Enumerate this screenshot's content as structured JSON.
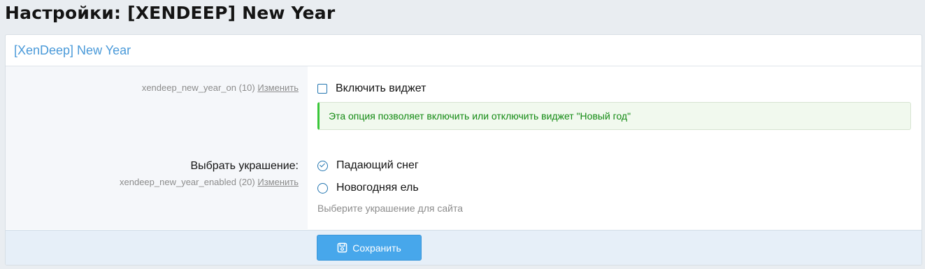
{
  "page": {
    "title": "Настройки: [XENDEEP] New Year"
  },
  "block": {
    "header": "[XenDeep] New Year",
    "row1": {
      "option_id": "xendeep_new_year_on (10)",
      "edit_link": "Изменить",
      "checkbox_label": "Включить виджет",
      "checkbox_checked": false,
      "hint": "Эта опция позволяет включить или отключить виджет \"Новый год\""
    },
    "row2": {
      "title": "Выбрать украшение:",
      "option_id": "xendeep_new_year_enabled (20)",
      "edit_link": "Изменить",
      "options": [
        {
          "label": "Падающий снег",
          "selected": true
        },
        {
          "label": "Новогодняя ель",
          "selected": false
        }
      ],
      "hint": "Выберите украшение для сайта"
    },
    "footer": {
      "save_label": "Сохранить"
    }
  },
  "colors": {
    "accent": "#2577b1",
    "button": "#47a7eb",
    "success": "#138a13"
  }
}
